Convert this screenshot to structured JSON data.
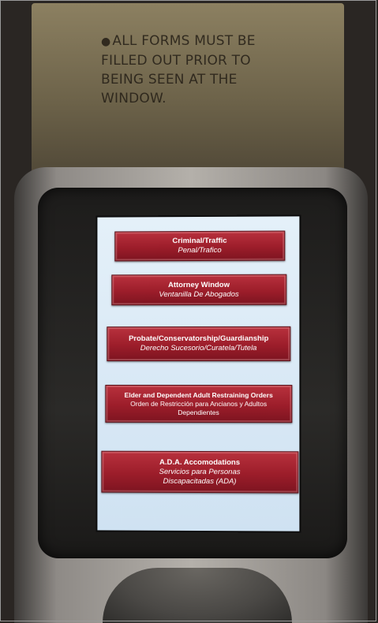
{
  "sign": {
    "bullet": "●",
    "text": "ALL FORMS MUST BE\nFILLED OUT PRIOR TO\nBEING SEEN AT THE\nWINDOW."
  },
  "menu": {
    "criminal": {
      "en": "Criminal/Traffic",
      "es": "Penal/Trafico"
    },
    "attorney": {
      "en": "Attorney Window",
      "es": "Ventanilla De Abogados"
    },
    "probate": {
      "en": "Probate/Conservatorship/Guardianship",
      "es": "Derecho Sucesorio/Curatela/Tutela"
    },
    "elder": {
      "en": "Elder and Dependent Adult Restraining Orders",
      "es_line1": "Orden de Restricción para Ancianos y Adultos",
      "es_line2": "Dependientes"
    },
    "ada": {
      "en": "A.D.A. Accomodations",
      "es_line1": "Servicios para Personas",
      "es_line2": "Discapacitadas (ADA)"
    }
  },
  "colors": {
    "button_red": "#9c1d2a",
    "screen_bg": "#dcebf7"
  }
}
